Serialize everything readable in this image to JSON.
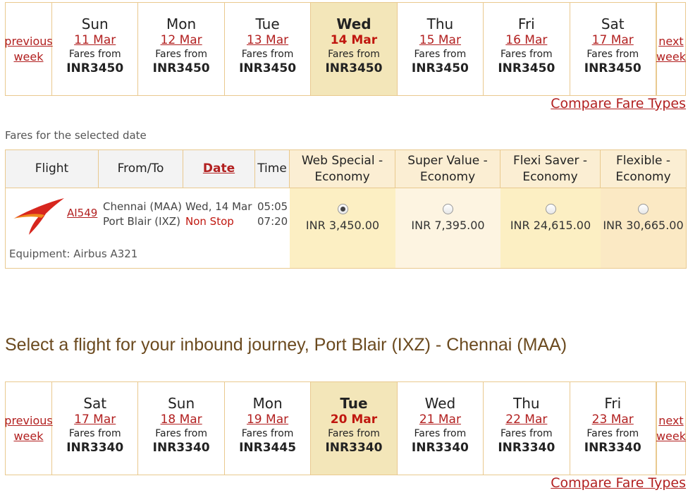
{
  "outbound_strip": {
    "prev_label": "previous week",
    "next_label": "next week",
    "fares_from_label": "Fares from",
    "days": [
      {
        "day": "Sun",
        "date": "11 Mar",
        "fare": "INR3450",
        "selected": false
      },
      {
        "day": "Mon",
        "date": "12 Mar",
        "fare": "INR3450",
        "selected": false
      },
      {
        "day": "Tue",
        "date": "13 Mar",
        "fare": "INR3450",
        "selected": false
      },
      {
        "day": "Wed",
        "date": "14 Mar",
        "fare": "INR3450",
        "selected": true
      },
      {
        "day": "Thu",
        "date": "15 Mar",
        "fare": "INR3450",
        "selected": false
      },
      {
        "day": "Fri",
        "date": "16 Mar",
        "fare": "INR3450",
        "selected": false
      },
      {
        "day": "Sat",
        "date": "17 Mar",
        "fare": "INR3450",
        "selected": false
      }
    ]
  },
  "compare_fare_types_label": "Compare Fare Types",
  "fares_subheading": "Fares for the selected date",
  "fares_table": {
    "headers": {
      "flight": "Flight",
      "from_to": "From/To",
      "date": "Date",
      "time": "Time",
      "web_special": "Web Special - Economy",
      "super_value": "Super Value - Economy",
      "flexi_saver": "Flexi Saver - Economy",
      "flexible": "Flexible - Economy"
    },
    "row": {
      "flight_number": "AI549",
      "from": "Chennai (MAA)",
      "to": "Port Blair (IXZ)",
      "date": "Wed, 14 Mar",
      "stops": "Non Stop",
      "depart_time": "05:05",
      "arrive_time": "07:20",
      "equipment": "Equipment: Airbus A321",
      "fares": [
        {
          "amount": "INR 3,450.00",
          "selected": true
        },
        {
          "amount": "INR 7,395.00",
          "selected": false
        },
        {
          "amount": "INR 24,615.00",
          "selected": false
        },
        {
          "amount": "INR 30,665.00",
          "selected": false
        }
      ]
    },
    "fare_column_colors": [
      "#fcefc3",
      "#fdf4e1",
      "#fcefc3",
      "#fbe9c4"
    ]
  },
  "inbound_title": "Select a flight for your inbound journey, Port Blair (IXZ) - Chennai (MAA)",
  "inbound_strip": {
    "prev_label": "previous week",
    "next_label": "next week",
    "fares_from_label": "Fares from",
    "days": [
      {
        "day": "Sat",
        "date": "17 Mar",
        "fare": "INR3340",
        "selected": false
      },
      {
        "day": "Sun",
        "date": "18 Mar",
        "fare": "INR3340",
        "selected": false
      },
      {
        "day": "Mon",
        "date": "19 Mar",
        "fare": "INR3445",
        "selected": false
      },
      {
        "day": "Tue",
        "date": "20 Mar",
        "fare": "INR3340",
        "selected": true
      },
      {
        "day": "Wed",
        "date": "21 Mar",
        "fare": "INR3340",
        "selected": false
      },
      {
        "day": "Thu",
        "date": "22 Mar",
        "fare": "INR3340",
        "selected": false
      },
      {
        "day": "Fri",
        "date": "23 Mar",
        "fare": "INR3340",
        "selected": false
      }
    ]
  },
  "colors": {
    "accent_red": "#c0170f",
    "border": "#e9c98f",
    "selected_day_bg": "#f3e6b9",
    "title_brown": "#6b4a1f"
  }
}
